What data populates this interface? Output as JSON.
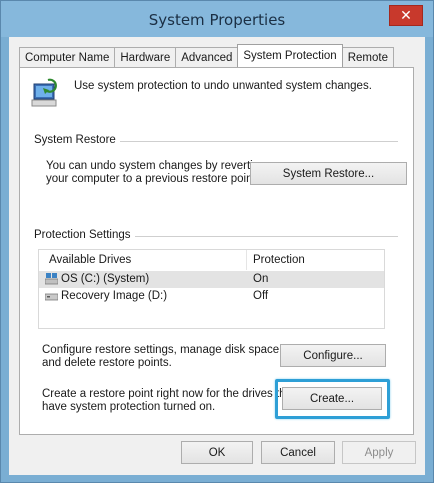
{
  "window": {
    "title": "System Properties",
    "close_glyph": "✕"
  },
  "tabs": [
    {
      "label": "Computer Name",
      "active": false
    },
    {
      "label": "Hardware",
      "active": false
    },
    {
      "label": "Advanced",
      "active": false
    },
    {
      "label": "System Protection",
      "active": true
    },
    {
      "label": "Remote",
      "active": false
    }
  ],
  "intro": {
    "icon": "system-protection-icon",
    "text": "Use system protection to undo unwanted system changes."
  },
  "system_restore": {
    "group_title": "System Restore",
    "description_line1": "You can undo system changes by reverting",
    "description_line2": "your computer to a previous restore point.",
    "button_label": "System Restore..."
  },
  "protection_settings": {
    "group_title": "Protection Settings",
    "columns": {
      "drives": "Available Drives",
      "protection": "Protection"
    },
    "drives": [
      {
        "name": "OS (C:) (System)",
        "protection": "On",
        "icon": "system-drive-icon",
        "selected": true
      },
      {
        "name": "Recovery Image (D:)",
        "protection": "Off",
        "icon": "drive-icon",
        "selected": false
      }
    ],
    "configure_text_line1": "Configure restore settings, manage disk space,",
    "configure_text_line2": "and delete restore points.",
    "configure_button": "Configure...",
    "create_text_line1": "Create a restore point right now for the drives that",
    "create_text_line2": "have system protection turned on.",
    "create_button": "Create..."
  },
  "footer": {
    "ok": "OK",
    "cancel": "Cancel",
    "apply": "Apply"
  },
  "colors": {
    "title_bar": "#86b8dc",
    "close_button": "#c8392c",
    "highlight": "#2e9fd6"
  }
}
